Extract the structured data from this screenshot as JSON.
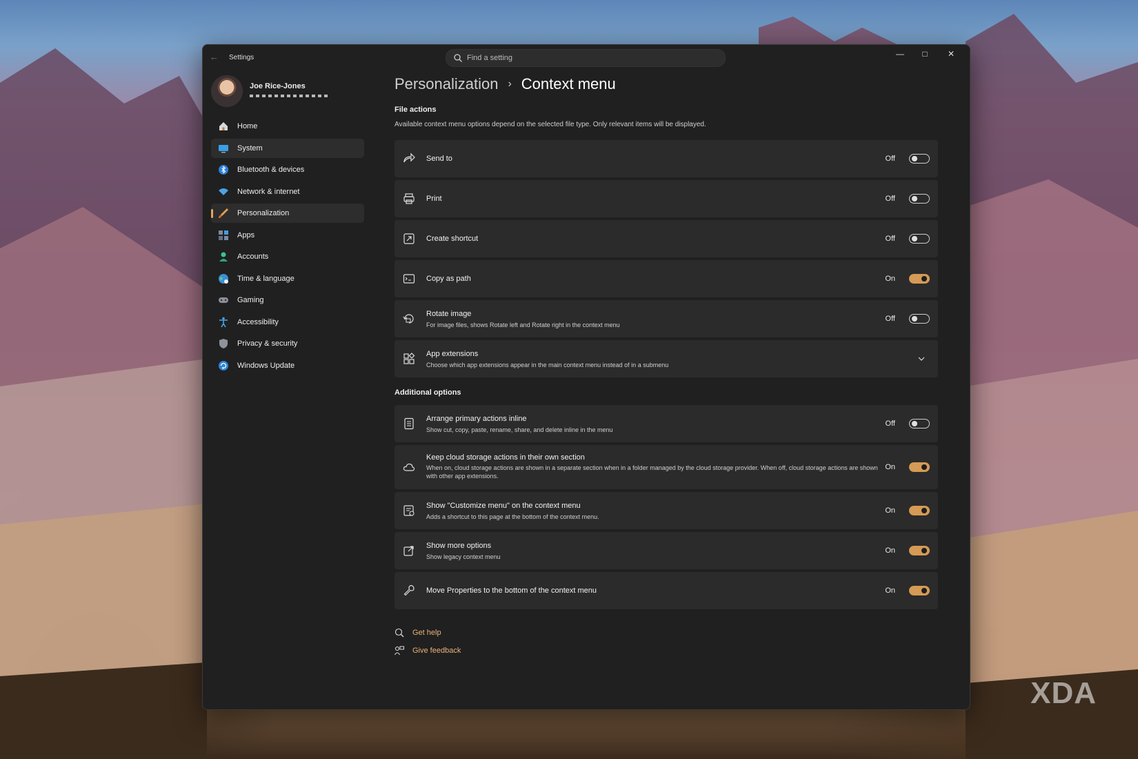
{
  "window": {
    "title": "Settings",
    "search_placeholder": "Find a setting"
  },
  "profile": {
    "name": "Joe Rice-Jones"
  },
  "nav": [
    {
      "label": "Home",
      "icon": "home-icon"
    },
    {
      "label": "System",
      "icon": "system-icon"
    },
    {
      "label": "Bluetooth & devices",
      "icon": "bluetooth-icon"
    },
    {
      "label": "Network & internet",
      "icon": "wifi-icon"
    },
    {
      "label": "Personalization",
      "icon": "brush-icon",
      "active": true
    },
    {
      "label": "Apps",
      "icon": "apps-icon"
    },
    {
      "label": "Accounts",
      "icon": "accounts-icon"
    },
    {
      "label": "Time & language",
      "icon": "globe-icon"
    },
    {
      "label": "Gaming",
      "icon": "gamepad-icon"
    },
    {
      "label": "Accessibility",
      "icon": "accessibility-icon"
    },
    {
      "label": "Privacy & security",
      "icon": "shield-icon"
    },
    {
      "label": "Windows Update",
      "icon": "update-icon"
    }
  ],
  "breadcrumb": {
    "parent": "Personalization",
    "current": "Context menu"
  },
  "file_actions": {
    "heading": "File actions",
    "description": "Available context menu options depend on the selected file type. Only relevant items will be displayed.",
    "rows": [
      {
        "title": "Send to",
        "state": "Off",
        "on": false,
        "icon": "send-to-icon"
      },
      {
        "title": "Print",
        "state": "Off",
        "on": false,
        "icon": "printer-icon"
      },
      {
        "title": "Create shortcut",
        "state": "Off",
        "on": false,
        "icon": "shortcut-icon"
      },
      {
        "title": "Copy as path",
        "state": "On",
        "on": true,
        "icon": "path-icon"
      },
      {
        "title": "Rotate image",
        "subtitle": "For image files, shows Rotate left and Rotate right in the context menu",
        "state": "Off",
        "on": false,
        "icon": "rotate-icon"
      },
      {
        "title": "App extensions",
        "subtitle": "Choose which app extensions appear in the main context menu instead of in a submenu",
        "icon": "extensions-icon"
      }
    ]
  },
  "additional_options": {
    "heading": "Additional options",
    "rows": [
      {
        "title": "Arrange primary actions inline",
        "subtitle": "Show cut, copy, paste, rename, share, and delete inline in the menu",
        "state": "Off",
        "on": false,
        "icon": "list-icon"
      },
      {
        "title": "Keep cloud storage actions in their own section",
        "subtitle": "When on, cloud storage actions are shown in a separate section when in a folder managed by the cloud storage provider. When off, cloud storage actions are shown with other app extensions.",
        "state": "On",
        "on": true,
        "icon": "cloud-icon"
      },
      {
        "title": "Show \"Customize menu\" on the context menu",
        "subtitle": "Adds a shortcut to this page at the bottom of the context menu.",
        "state": "On",
        "on": true,
        "icon": "customize-icon"
      },
      {
        "title": "Show more options",
        "subtitle": "Show legacy context menu",
        "state": "On",
        "on": true,
        "icon": "more-options-icon"
      },
      {
        "title": "Move Properties to the bottom of the context menu",
        "state": "On",
        "on": true,
        "icon": "wrench-icon"
      }
    ]
  },
  "links": {
    "help": "Get help",
    "feedback": "Give feedback"
  },
  "watermark": "XDA",
  "colors": {
    "accent": "#d59a55",
    "link": "#e8b37a",
    "window_bg": "#202020",
    "card_bg": "#2b2b2b"
  }
}
